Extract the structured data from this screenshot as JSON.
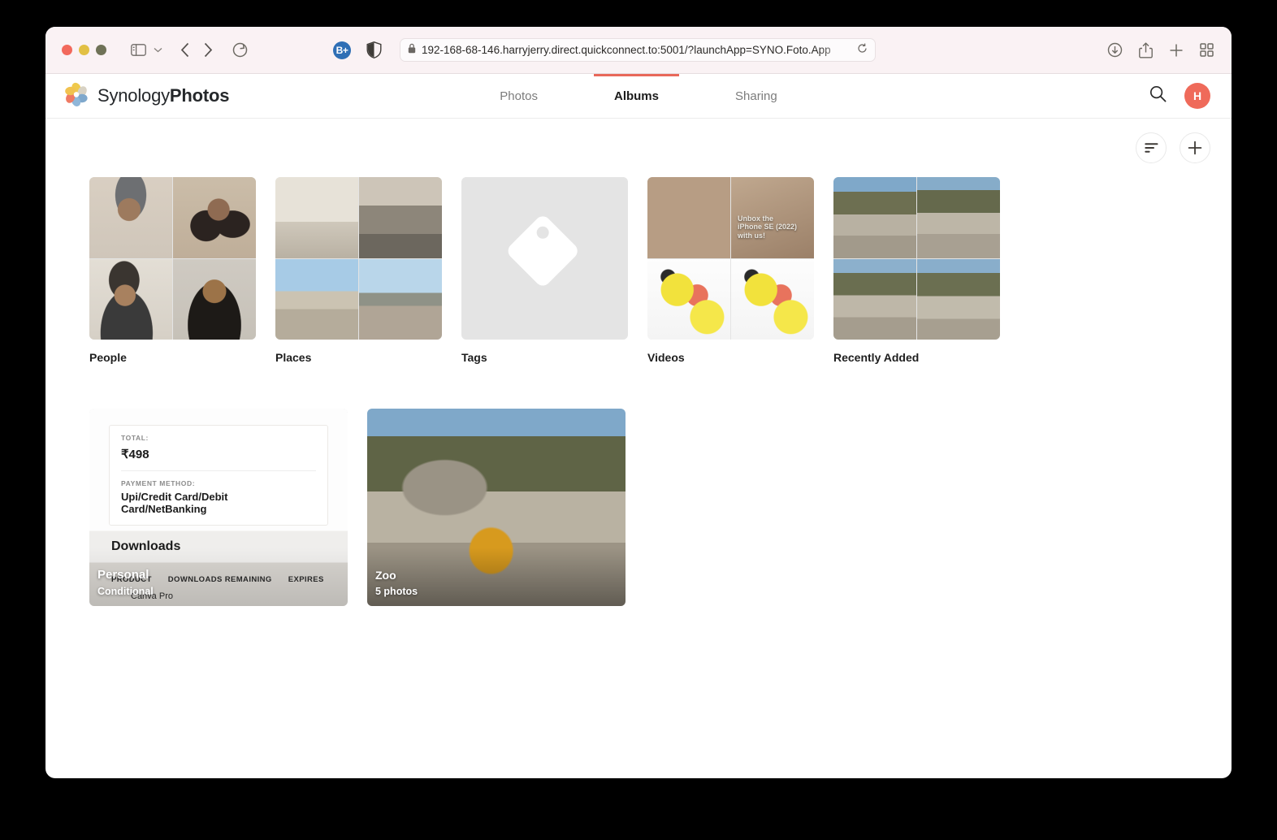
{
  "browser": {
    "url": "192-168-68-146.harryjerry.direct.quickconnect.to:5001/?launchApp=SYNO.Foto.App",
    "extension_badge": "B+",
    "icons": {
      "sidebar": "sidebar-icon",
      "back": "back-arrow-icon",
      "forward": "forward-arrow-icon",
      "reload": "reload-icon",
      "shield": "privacy-shield-icon",
      "lock": "lock-icon",
      "download": "download-icon",
      "share": "share-icon",
      "new_tab": "plus-icon",
      "tab_overview": "tab-overview-icon"
    }
  },
  "app": {
    "brand_light": "Synology",
    "brand_bold": "Photos",
    "tabs": [
      {
        "label": "Photos",
        "active": false
      },
      {
        "label": "Albums",
        "active": true
      },
      {
        "label": "Sharing",
        "active": false
      }
    ],
    "search_icon": "search-icon",
    "avatar_initial": "H",
    "accent_color": "#e8685a",
    "avatar_color": "#ef6a5a",
    "actions": {
      "sort_label": "sort-icon",
      "add_label": "plus-icon"
    }
  },
  "albums": {
    "smart": [
      {
        "label": "People"
      },
      {
        "label": "Places"
      },
      {
        "label": "Tags"
      },
      {
        "label": "Videos"
      },
      {
        "label": "Recently Added"
      }
    ],
    "user": [
      {
        "title": "Personal",
        "subtitle": "Conditional"
      },
      {
        "title": "Zoo",
        "subtitle": "5 photos"
      }
    ]
  },
  "thumbnails": {
    "videos_caption": "Unbox the\niPhone SE (2022)\nwith us!",
    "invoice": {
      "total_label": "TOTAL:",
      "total_value": "₹498",
      "payment_label": "PAYMENT METHOD:",
      "payment_value": "Upi/Credit Card/Debit Card/NetBanking",
      "downloads_heading": "Downloads",
      "col_product": "PRODUCT",
      "col_remaining": "DOWNLOADS REMAINING",
      "col_expires": "EXPIRES",
      "product_name": "Canva Pro"
    }
  }
}
